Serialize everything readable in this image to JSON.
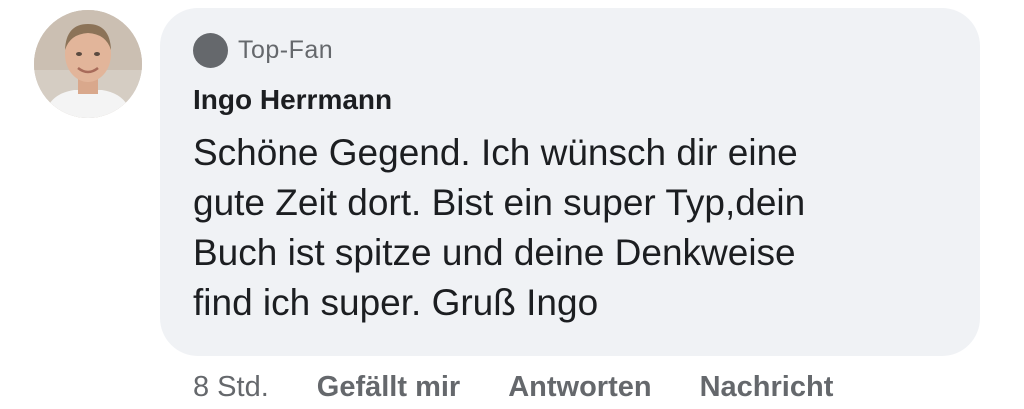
{
  "comment": {
    "badge": "Top-Fan",
    "author": "Ingo Herrmann",
    "text": "Schöne Gegend.  Ich wünsch dir eine\ngute Zeit dort.  Bist ein super Typ,dein\nBuch ist spitze und deine Denkweise\nfind ich  super. Gruß Ingo",
    "time": "8 Std.",
    "actions": {
      "like": "Gefällt mir",
      "reply": "Antworten",
      "message": "Nachricht"
    }
  },
  "colors": {
    "bubble": "#f0f2f5",
    "secondary_text": "#65686c",
    "primary_text": "#1c1e21"
  },
  "icons": {
    "badge": "top-fan-badge-icon",
    "avatar": "user-avatar"
  }
}
